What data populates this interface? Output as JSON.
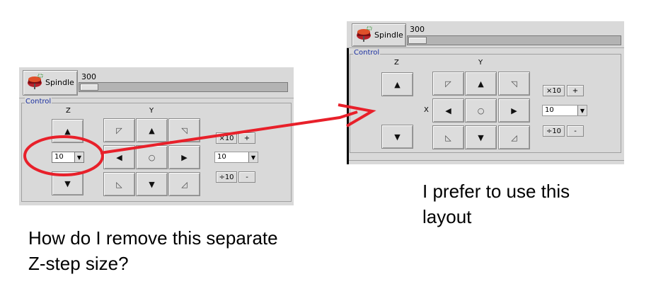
{
  "left": {
    "spindle_label": "Spindle",
    "spindle_value": "300",
    "spindle_slider_fraction": 0.03,
    "control_legend": "Control",
    "axis_z": "Z",
    "axis_y": "Y",
    "z_step_value": "10",
    "step_value": "10",
    "x10_label": "×10",
    "plus_label": "+",
    "div10_label": "÷10",
    "minus_label": "-"
  },
  "right": {
    "spindle_label": "Spindle",
    "spindle_value": "300",
    "spindle_slider_fraction": 0.03,
    "control_legend": "Control",
    "axis_z": "Z",
    "axis_y": "Y",
    "axis_x": "X",
    "step_value": "10",
    "x10_label": "×10",
    "plus_label": "+",
    "div10_label": "÷10",
    "minus_label": "-"
  },
  "glyphs": {
    "up": "▲",
    "down": "▼",
    "left": "◀",
    "right": "▶",
    "home": "○",
    "nw": "◸",
    "ne": "◹",
    "sw": "◺",
    "se": "◿",
    "combo_arrow": "▼"
  },
  "captions": {
    "question": "How do I remove this separate Z-step size?",
    "question_line1": "How do I remove this separate",
    "question_line2": "Z-step size?",
    "prefer_line1": "I prefer to use this",
    "prefer_line2": "layout"
  },
  "colors": {
    "annotation_red": "#e8202a",
    "legend_blue": "#1a2fa0",
    "panel_gray": "#d9d9d9"
  }
}
